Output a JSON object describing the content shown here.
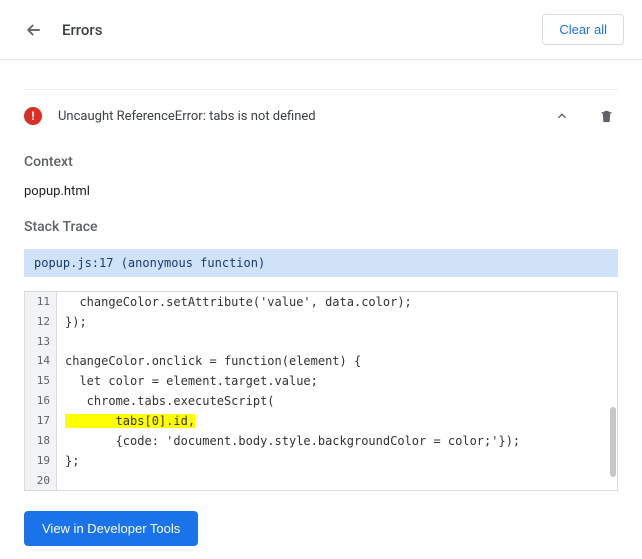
{
  "header": {
    "title": "Errors",
    "clear_all_label": "Clear all"
  },
  "error": {
    "message": "Uncaught ReferenceError: tabs is not defined",
    "icon_glyph": "!"
  },
  "sections": {
    "context_heading": "Context",
    "context_value": "popup.html",
    "stack_heading": "Stack Trace",
    "trace_location": "popup.js:17 (anonymous function)"
  },
  "code": {
    "lines": [
      {
        "n": "11",
        "text": "  changeColor.setAttribute('value', data.color);",
        "hl": false
      },
      {
        "n": "12",
        "text": "});",
        "hl": false
      },
      {
        "n": "13",
        "text": "",
        "hl": false
      },
      {
        "n": "14",
        "text": "changeColor.onclick = function(element) {",
        "hl": false
      },
      {
        "n": "15",
        "text": "  let color = element.target.value;",
        "hl": false
      },
      {
        "n": "16",
        "text": "   chrome.tabs.executeScript(",
        "hl": false
      },
      {
        "n": "17",
        "text": "       tabs[0].id,",
        "hl": true
      },
      {
        "n": "18",
        "text": "       {code: 'document.body.style.backgroundColor = color;'});",
        "hl": false
      },
      {
        "n": "19",
        "text": "};",
        "hl": false
      },
      {
        "n": "20",
        "text": "",
        "hl": false
      }
    ]
  },
  "buttons": {
    "view_devtools": "View in Developer Tools"
  }
}
